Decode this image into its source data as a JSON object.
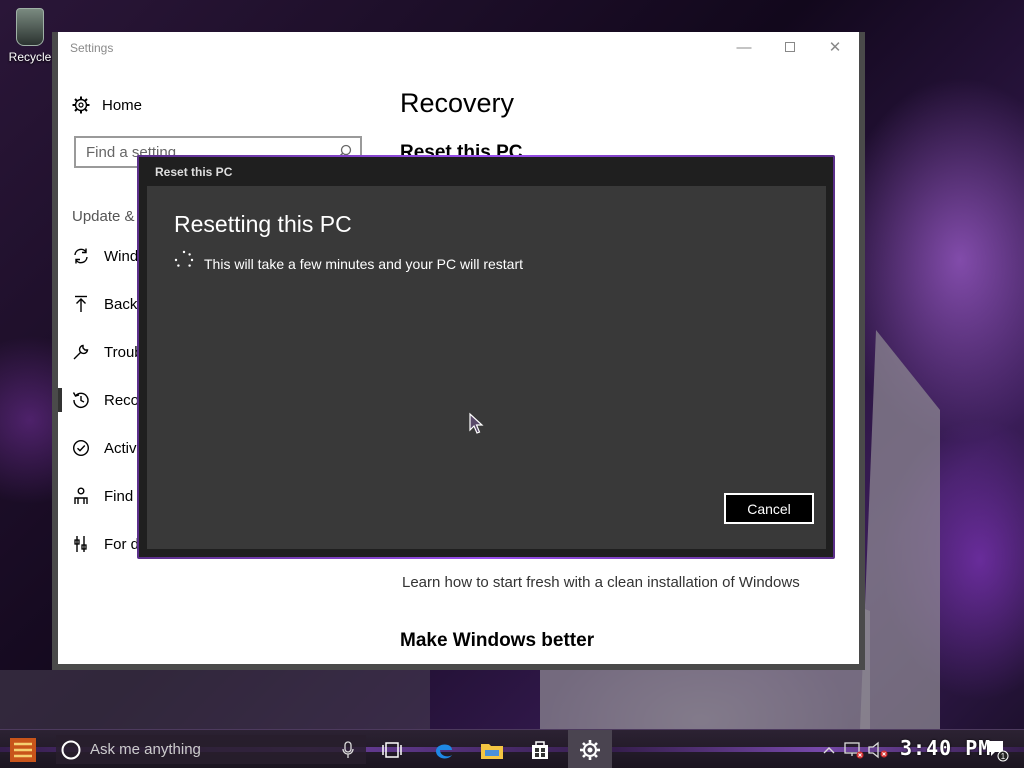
{
  "desktop": {
    "recycle_label": "Recycle"
  },
  "settings": {
    "window_title": "Settings",
    "nav": {
      "home_label": "Home",
      "search_placeholder": "Find a setting",
      "section_label": "Update &",
      "items": [
        {
          "label": "Wind",
          "icon": "refresh-icon"
        },
        {
          "label": "Backu",
          "icon": "upload-arrow-icon"
        },
        {
          "label": "Troub",
          "icon": "wrench-icon"
        },
        {
          "label": "Reco",
          "icon": "history-icon",
          "active": true
        },
        {
          "label": "Activ",
          "icon": "check-circle-icon"
        },
        {
          "label": "Find",
          "icon": "person-icon"
        },
        {
          "label": "For d",
          "icon": "developer-icon"
        }
      ]
    },
    "page_title": "Recovery",
    "section_title": "Reset this PC",
    "learn_link": "Learn how to start fresh with a clean installation of Windows",
    "make_better": "Make Windows better"
  },
  "dialog": {
    "title": "Reset this PC",
    "heading": "Resetting this PC",
    "message": "This will take a few minutes and your PC will restart",
    "cancel_label": "Cancel"
  },
  "taskbar": {
    "search_placeholder": "Ask me anything",
    "clock": "3:40 PM",
    "notification_count": "1"
  },
  "colors": {
    "dialog_bg": "#393939",
    "dialog_frame": "#1f1f1f",
    "accent_purple": "#9b4ff0"
  }
}
